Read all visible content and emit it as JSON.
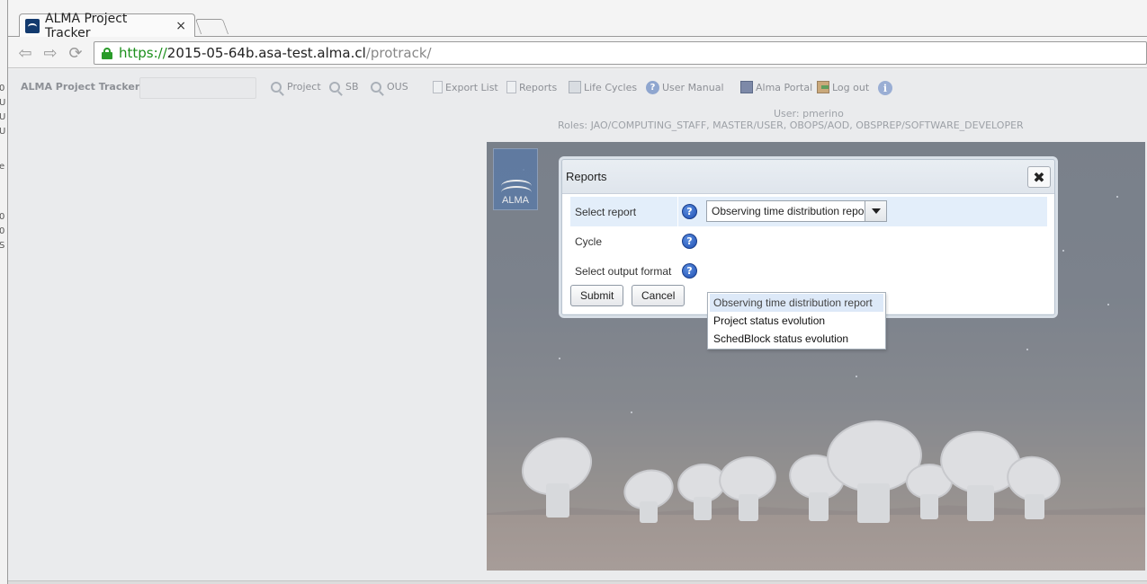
{
  "browser": {
    "tab_title": "ALMA Project Tracker",
    "tab_close": "×",
    "url_scheme": "https://",
    "url_host": "2015-05-64b.asa-test.alma.cl",
    "url_path": "/protrack/"
  },
  "menubar": {
    "app_title": "ALMA Project Tracker",
    "search_value": "",
    "items": [
      {
        "label": "Project",
        "icon": "magnifier-icon"
      },
      {
        "label": "SB",
        "icon": "magnifier-icon"
      },
      {
        "label": "OUS",
        "icon": "magnifier-icon"
      },
      {
        "label": "Export List",
        "icon": "document-icon"
      },
      {
        "label": "Reports",
        "icon": "document-icon"
      },
      {
        "label": "Life Cycles",
        "icon": "cycle-icon"
      },
      {
        "label": "User Manual",
        "icon": "question-icon"
      },
      {
        "label": "Alma Portal",
        "icon": "portal-icon"
      },
      {
        "label": "Log out",
        "icon": "logout-icon"
      }
    ],
    "info_glyph": "i"
  },
  "user": {
    "user_line": "User: pmerino",
    "roles_line": "Roles: JAO/COMPUTING_STAFF, MASTER/USER, OBOPS/AOD, OBSPREP/SOFTWARE_DEVELOPER"
  },
  "logo": {
    "text": "ALMA"
  },
  "dialog": {
    "title": "Reports",
    "close_glyph": "✖",
    "fields": [
      {
        "label": "Select report",
        "help": "?"
      },
      {
        "label": "Cycle",
        "help": "?"
      },
      {
        "label": "Select output format",
        "help": "?"
      }
    ],
    "report_select_value": "Observing time distribution report",
    "submit_label": "Submit",
    "cancel_label": "Cancel",
    "dropdown_options": [
      "Observing time distribution report",
      "Project status evolution",
      "SchedBlock status evolution"
    ]
  },
  "colors": {
    "accent": "#1f4fb2",
    "page_bg": "#eaebed",
    "url_green": "#1b8f1b"
  }
}
